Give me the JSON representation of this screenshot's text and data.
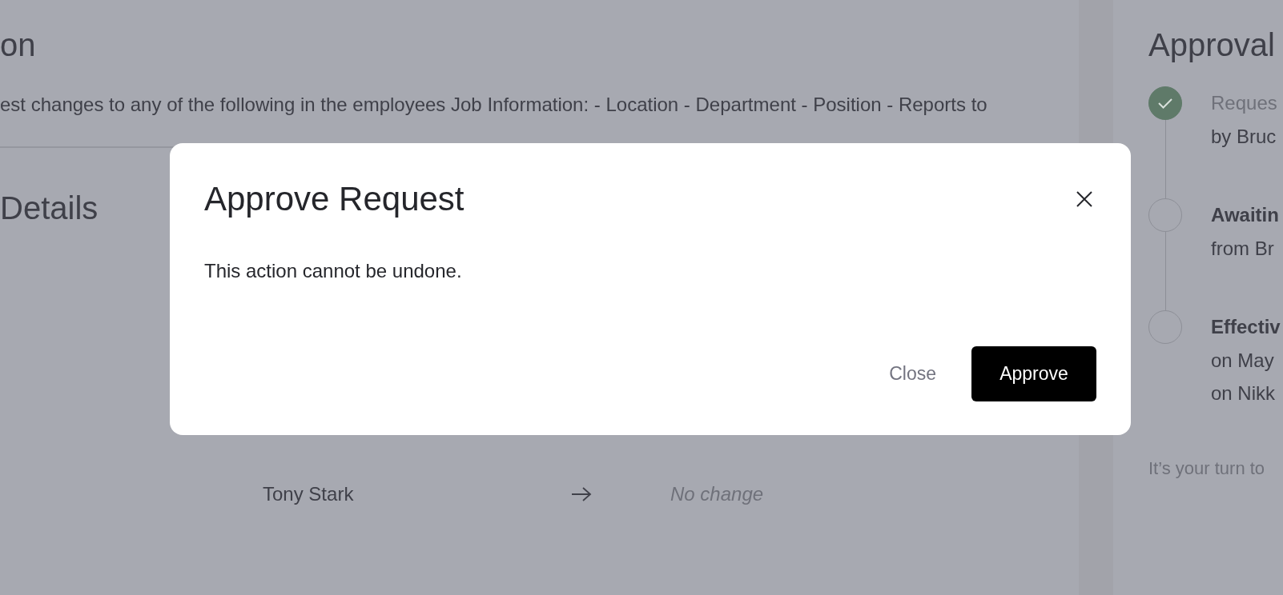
{
  "page": {
    "heading": "on",
    "description": "est changes to any of the following in the employees Job Information: - Location - Department - Position - Reports to",
    "section_heading": "Details",
    "rows": [
      {
        "from": "Tony Stark",
        "to": "No change"
      }
    ]
  },
  "approval_panel": {
    "heading": "Approval",
    "steps": [
      {
        "title": "Reques",
        "details": [
          "by Bruc"
        ],
        "completed": true
      },
      {
        "title": "Awaitin",
        "details": [
          "from Br"
        ],
        "completed": false
      },
      {
        "title": "Effectiv",
        "details": [
          "on May",
          "on Nikk"
        ],
        "completed": false
      }
    ],
    "footer": "It’s your turn to"
  },
  "modal": {
    "title": "Approve Request",
    "body": "This action cannot be undone.",
    "buttons": [
      {
        "label": "Close",
        "kind": "link"
      },
      {
        "label": "Approve",
        "kind": "primary"
      }
    ]
  }
}
